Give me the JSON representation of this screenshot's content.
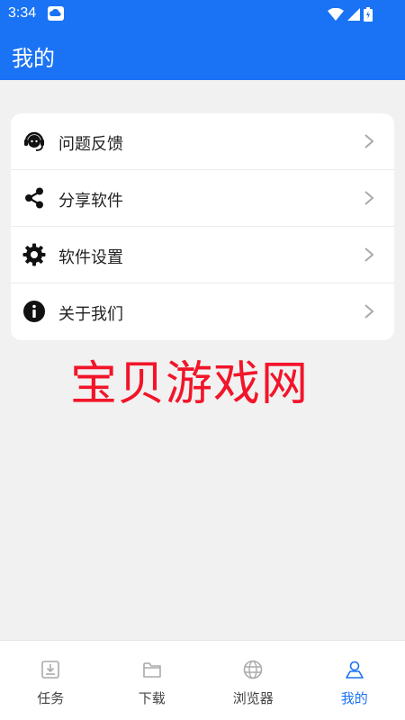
{
  "status_bar": {
    "time": "3:34"
  },
  "header": {
    "title": "我的"
  },
  "menu": {
    "items": [
      {
        "label": "问题反馈",
        "icon": "headset-icon"
      },
      {
        "label": "分享软件",
        "icon": "share-icon"
      },
      {
        "label": "软件设置",
        "icon": "gear-icon"
      },
      {
        "label": "关于我们",
        "icon": "info-icon"
      }
    ]
  },
  "watermark": {
    "text": "宝贝游戏网"
  },
  "tabbar": {
    "tabs": [
      {
        "label": "任务",
        "icon": "download-tray-icon",
        "active": false
      },
      {
        "label": "下载",
        "icon": "folder-icon",
        "active": false
      },
      {
        "label": "浏览器",
        "icon": "globe-icon",
        "active": false
      },
      {
        "label": "我的",
        "icon": "person-icon",
        "active": true
      }
    ]
  },
  "colors": {
    "accent": "#1a73f5",
    "background": "#f1f1f1",
    "watermark": "#f2152a"
  }
}
